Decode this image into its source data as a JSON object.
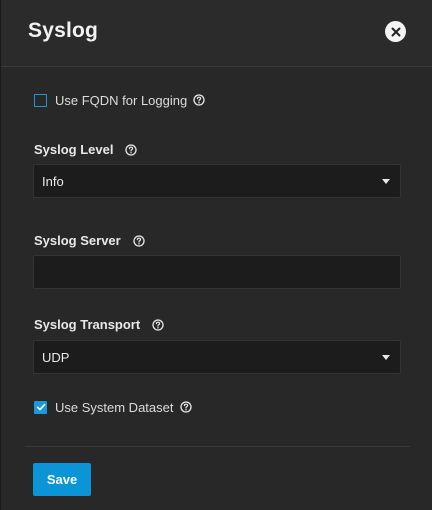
{
  "dialog": {
    "title": "Syslog"
  },
  "fields": {
    "use_fqdn": {
      "label": "Use FQDN for Logging",
      "checked": false
    },
    "syslog_level": {
      "label": "Syslog Level",
      "value": "Info"
    },
    "syslog_server": {
      "label": "Syslog Server",
      "value": "",
      "placeholder": ""
    },
    "syslog_transport": {
      "label": "Syslog Transport",
      "value": "UDP"
    },
    "use_system_dataset": {
      "label": "Use System Dataset",
      "checked": true
    }
  },
  "actions": {
    "save_label": "Save"
  },
  "colors": {
    "accent": "#0b95d7",
    "background": "#282828",
    "input_background": "#1c1c1c"
  },
  "icons": {
    "close": "close-icon",
    "help": "help-circle-icon",
    "dropdown": "caret-down-icon",
    "check": "checkmark-icon"
  }
}
